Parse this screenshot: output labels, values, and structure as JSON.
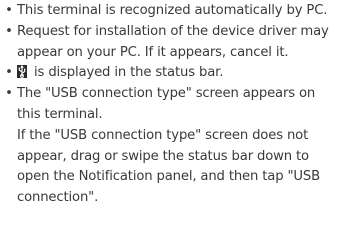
{
  "bullet_char": "•",
  "items": [
    {
      "text": "This terminal is recognized automatically by PC."
    },
    {
      "text": "Request for installation of the device driver may appear on your PC. If it appears, cancel it."
    },
    {
      "icon": "usb-icon",
      "text": " is displayed in the status bar."
    },
    {
      "text": "The \"USB connection type\" screen appears on this terminal.",
      "subtext": "If the \"USB connection type\" screen does not appear, drag or swipe the status bar down to open the Notification panel, and then tap \"USB connection\"."
    }
  ]
}
